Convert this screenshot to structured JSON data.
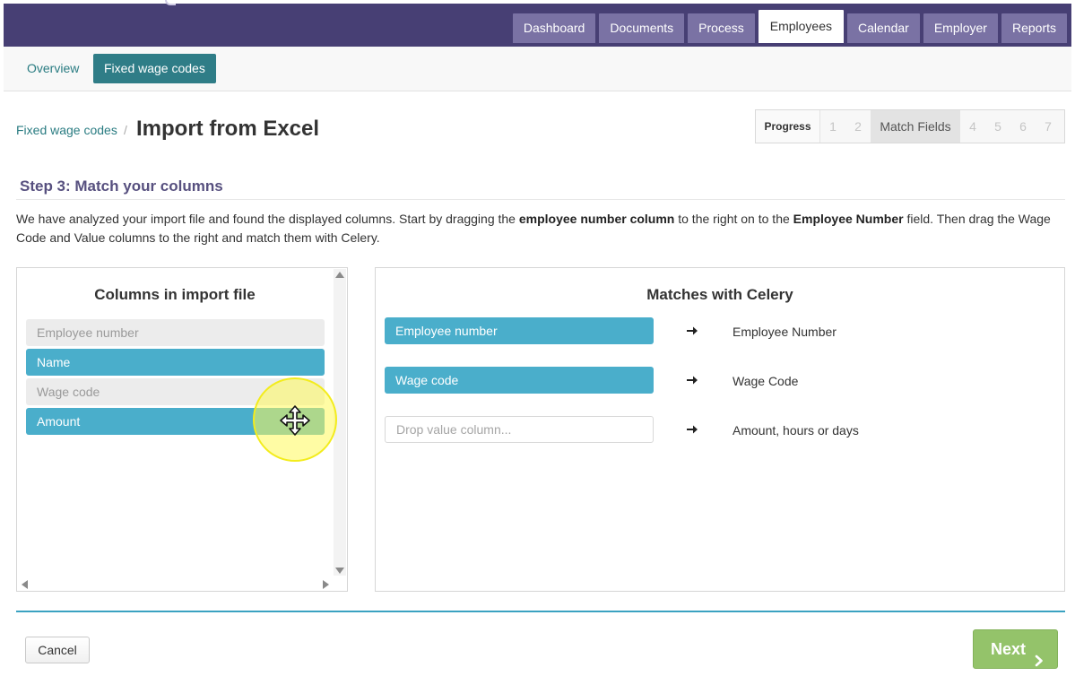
{
  "nav": {
    "tabs": [
      {
        "label": "Dashboard"
      },
      {
        "label": "Documents"
      },
      {
        "label": "Process"
      },
      {
        "label": "Employees"
      },
      {
        "label": "Calendar"
      },
      {
        "label": "Employer"
      },
      {
        "label": "Reports"
      }
    ],
    "active_tab": "Employees"
  },
  "subnav": {
    "items": [
      {
        "label": "Overview"
      },
      {
        "label": "Fixed wage codes"
      }
    ],
    "active": "Fixed wage codes"
  },
  "header": {
    "breadcrumb_link": "Fixed wage codes",
    "breadcrumb_separator": "/",
    "title": "Import from Excel"
  },
  "progress": {
    "label": "Progress",
    "steps": [
      "1",
      "2",
      "Match Fields",
      "4",
      "5",
      "6",
      "7"
    ],
    "current": "Match Fields"
  },
  "step": {
    "heading": "Step 3: Match your columns",
    "intro_part1": "We have analyzed your import file and found the displayed columns. Start by dragging the ",
    "intro_bold1": "employee number column",
    "intro_part2": " to the right on to the ",
    "intro_bold2": "Employee Number",
    "intro_part3": " field. Then drag the Wage Code and Value columns to the right and match them with Celery."
  },
  "import_columns": {
    "title": "Columns in import file",
    "items": [
      {
        "label": "Employee number",
        "state": "used"
      },
      {
        "label": "Name",
        "state": "available"
      },
      {
        "label": "Wage code",
        "state": "used"
      },
      {
        "label": "Amount",
        "state": "available"
      }
    ]
  },
  "matches": {
    "title": "Matches with Celery",
    "rows": [
      {
        "slot": "Employee number",
        "slot_placeholder": "",
        "target": "Employee Number"
      },
      {
        "slot": "Wage code",
        "slot_placeholder": "",
        "target": "Wage Code"
      },
      {
        "slot": "",
        "slot_placeholder": "Drop value column...",
        "target": "Amount, hours or days"
      }
    ]
  },
  "footer": {
    "cancel_label": "Cancel",
    "next_label": "Next"
  },
  "colors": {
    "topbar": "#473f74",
    "tab": "#7a72a4",
    "accent_teal": "#2f7d87",
    "column_blue": "#4aaecb",
    "next_green": "#94c36a",
    "heading_purple": "#57507f"
  },
  "icons": {
    "match_arrow": "arrow-right-icon",
    "drag_cursor": "move-cursor-icon",
    "next_chevron": "chevron-right-icon"
  }
}
